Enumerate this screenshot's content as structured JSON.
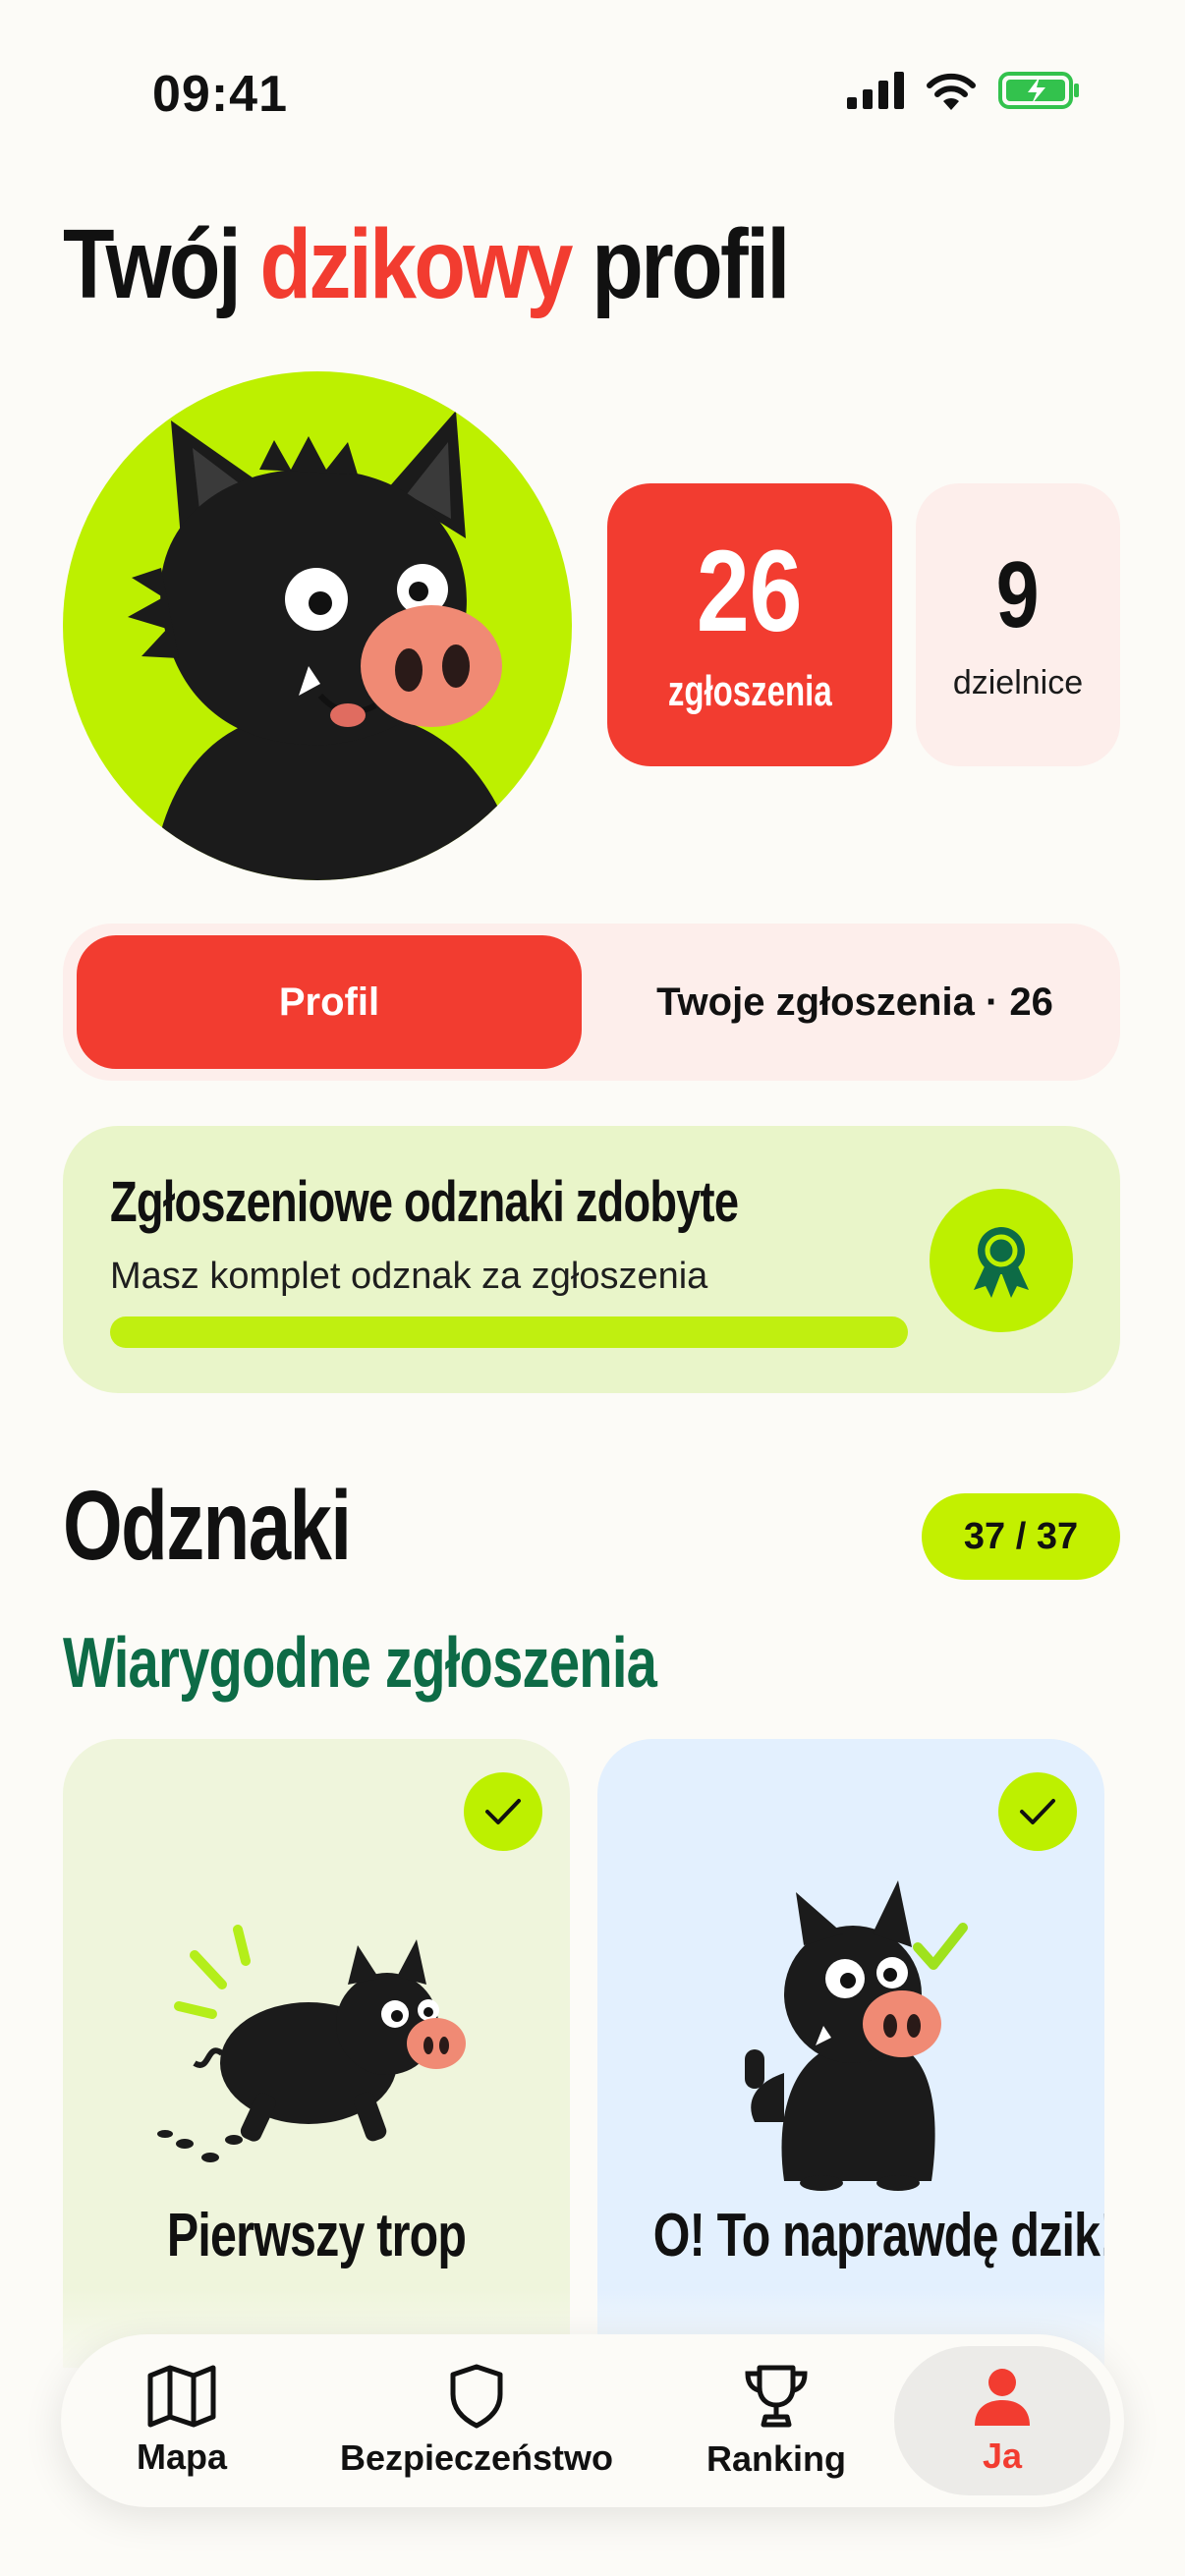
{
  "status": {
    "time": "09:41"
  },
  "title": {
    "prefix": "Twój",
    "accent": "dzikowy",
    "suffix": "profil"
  },
  "stats": {
    "reports": {
      "value": "26",
      "label": "zgłoszenia"
    },
    "districts": {
      "value": "9",
      "label": "dzielnice"
    }
  },
  "tabs": [
    {
      "label": "Profil",
      "active": true
    },
    {
      "label": "Twoje zgłoszenia · 26",
      "active": false
    }
  ],
  "banner": {
    "title": "Zgłoszeniowe odznaki zdobyte",
    "subtitle": "Masz komplet odznak za zgłoszenia",
    "progress": 1.0,
    "icon": "award-ribbon-icon"
  },
  "badges_section": {
    "title": "Odznaki",
    "count": "37 / 37"
  },
  "category": {
    "title": "Wiarygodne zgłoszenia"
  },
  "badges": [
    {
      "label": "Pierwszy trop",
      "earned": true
    },
    {
      "label": "O! To naprawdę dzik!",
      "earned": true
    }
  ],
  "nav": [
    {
      "label": "Mapa",
      "icon": "map-icon"
    },
    {
      "label": "Bezpieczeństwo",
      "icon": "shield-icon"
    },
    {
      "label": "Ranking",
      "icon": "trophy-icon"
    },
    {
      "label": "Ja",
      "icon": "user-icon",
      "active": true
    }
  ],
  "colors": {
    "accent": "#f23c30",
    "lime": "#bdf000",
    "green": "#0d6b46"
  }
}
